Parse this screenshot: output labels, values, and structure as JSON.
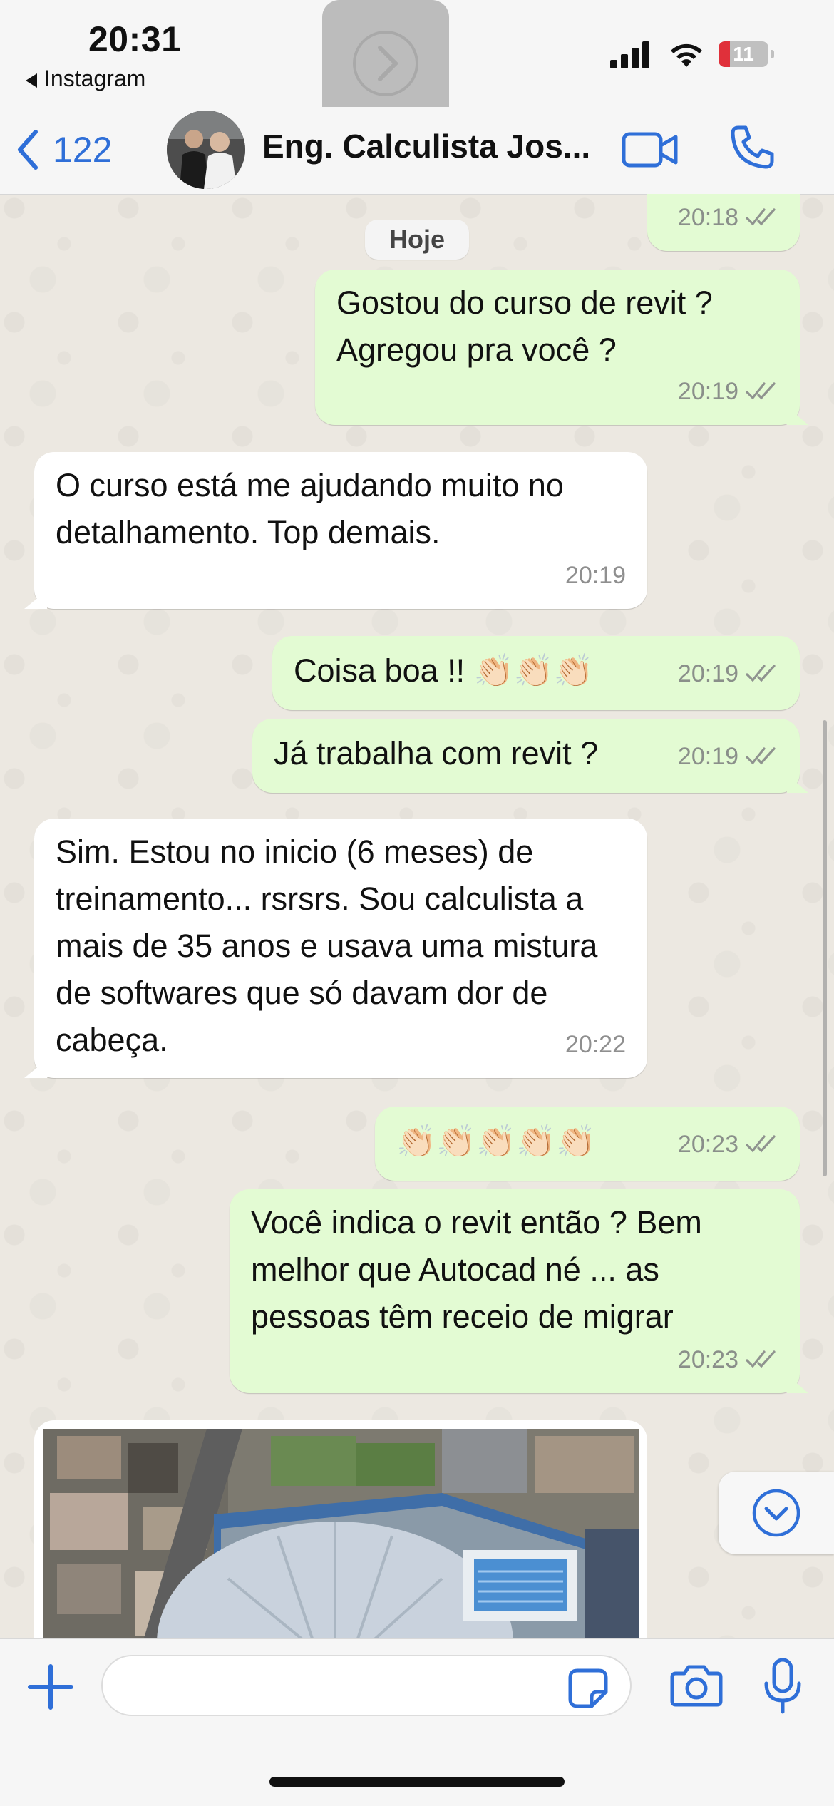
{
  "status_bar": {
    "time": "20:31",
    "back_app": "Instagram",
    "battery": "11"
  },
  "header": {
    "back_count": "122",
    "contact_name": "Eng. Calculista Jos..."
  },
  "day_label": "Hoje",
  "messages": [
    {
      "dir": "out",
      "text": "",
      "time": "20:18"
    },
    {
      "dir": "out",
      "text": "Gostou do curso de revit ? Agregou pra você ?",
      "time": "20:19"
    },
    {
      "dir": "in",
      "text": "O curso está me ajudando muito no detalhamento. Top demais.",
      "time": "20:19"
    },
    {
      "dir": "out",
      "text": "Coisa boa !! 👏🏻👏🏻👏🏻",
      "time": "20:19"
    },
    {
      "dir": "out",
      "text": "Já trabalha com revit ?",
      "time": "20:19"
    },
    {
      "dir": "in",
      "text": "Sim. Estou no inicio (6 meses) de treinamento... rsrsrs. Sou calculista a mais de 35 anos e usava uma mistura de softwares que só davam dor de cabeça.",
      "time": "20:22"
    },
    {
      "dir": "out",
      "text": "👏🏻👏🏻👏🏻👏🏻👏🏻",
      "time": "20:23"
    },
    {
      "dir": "out",
      "text": "Você indica o revit então ? Bem melhor que Autocad né ... as pessoas têm receio de migrar",
      "time": "20:23"
    }
  ],
  "composer": {
    "placeholder": ""
  },
  "colors": {
    "accent": "#2f6fd8",
    "outgoing_bubble": "#e3fbd3",
    "incoming_bubble": "#ffffff",
    "chat_background": "#ece8e1"
  },
  "icons": {
    "back": "chevron-left-icon",
    "video": "video-camera-icon",
    "call": "phone-icon",
    "plus": "plus-icon",
    "sticker": "sticker-icon",
    "camera": "camera-icon",
    "mic": "microphone-icon",
    "scroll_down": "chevron-down-circle-icon"
  }
}
